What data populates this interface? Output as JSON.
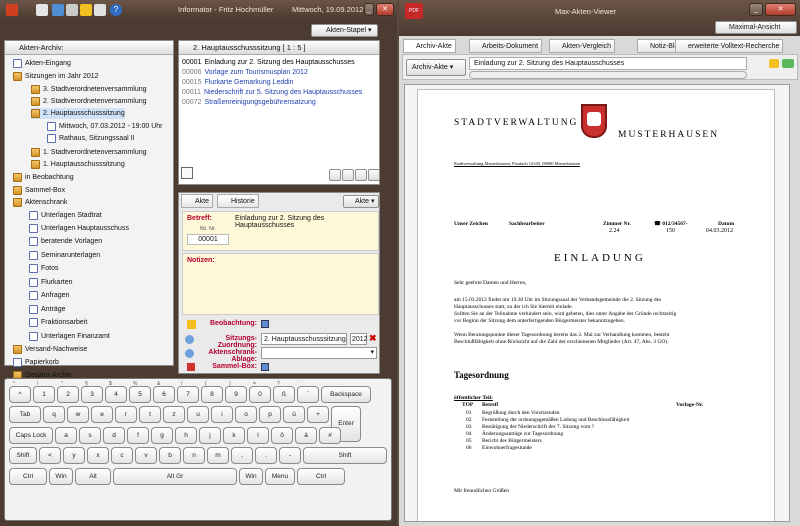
{
  "left_window": {
    "title_user": "Informator - Fritz Hochmüller",
    "title_date": "Mittwoch, 19.09.2012"
  },
  "right_window": {
    "title": "Max-Akten-Viewer",
    "maximal_button": "Maximal-Ansicht"
  },
  "archive": {
    "header": "Akten-Archiv:",
    "tree": [
      {
        "label": "Akten-Eingang"
      },
      {
        "label": "Sitzungen im Jahr 2012"
      },
      {
        "label": "3. Stadtverordnetenversammlung"
      },
      {
        "label": "2. Stadtverordnetenversammlung"
      },
      {
        "label": "2. Hauptausschusssitzung"
      },
      {
        "label": "Mittwoch, 07.03.2012 - 19:00 Uhr"
      },
      {
        "label": "Rathaus, Sitzungssaal  II"
      },
      {
        "label": "1. Stadtverordnetenversammlung"
      },
      {
        "label": "1. Hauptausschusssitzung"
      },
      {
        "label": "in Beobachtung"
      },
      {
        "label": "Sammel-Box"
      },
      {
        "label": "Aktenschrank"
      },
      {
        "label": "Unterlagen Stadtrat"
      },
      {
        "label": "Unterlagen Hauptausschuss"
      },
      {
        "label": "beratende Vorlagen"
      },
      {
        "label": "Seminarunterlagen"
      },
      {
        "label": "Fotos"
      },
      {
        "label": "Flurkarten"
      },
      {
        "label": "Anfragen"
      },
      {
        "label": "Anträge"
      },
      {
        "label": "Fraktionsarbeit"
      },
      {
        "label": "Unterlagen Finanzamt"
      },
      {
        "label": "Versand-Nachweise"
      },
      {
        "label": "Papierkorb"
      },
      {
        "label": "Gesamt-Archiv"
      }
    ]
  },
  "stapel": {
    "button": "Akten-Stapel"
  },
  "session": {
    "header": "2. Hauptausschusssitzung   [ 1 : 5 ]",
    "items": [
      {
        "num": "00001",
        "text": "Einladung zur 2. Sitzung des Hauptausschusses"
      },
      {
        "num": "00006",
        "text": "Vorlage zum Tourismusplan 2012"
      },
      {
        "num": "00015",
        "text": "Flurkarte Gemarkung Leddin"
      },
      {
        "num": "00011",
        "text": "Niederschrift zur 5. Sitzung des Hauptausschusses"
      },
      {
        "num": "00072",
        "text": "Straßenreinigungsgebührensatzung"
      }
    ]
  },
  "akte": {
    "tab_akte": "Akte",
    "tab_historie": "Historie",
    "akte_button": "Akte",
    "betreff_label": "Betreff:",
    "lfd_label": "lfd. Nr.",
    "lfd_value": "00001",
    "betreff_value": "Einladung zur 2. Sitzung des Hauptausschusses",
    "notizen_label": "Notizen:",
    "beobachtung_label": "Beobachtung:",
    "sitzung_label": "Sitzungs-Zuordnung:",
    "sitzung_value": "2. Hauptausschusssitzung",
    "sitzung_year": "2012",
    "aktenschrank_label": "Aktenschrank-Ablage:",
    "sammelbox_label": "Sammel-Box:"
  },
  "keyboard": {
    "row1": [
      "^",
      "1",
      "2",
      "3",
      "4",
      "5",
      "6",
      "7",
      "8",
      "9",
      "0",
      "ß",
      "´",
      "Backspace"
    ],
    "row2": [
      "Tab",
      "q",
      "w",
      "e",
      "r",
      "t",
      "z",
      "u",
      "i",
      "o",
      "p",
      "ü",
      "+",
      "Enter"
    ],
    "row3": [
      "Caps Lock",
      "a",
      "s",
      "d",
      "f",
      "g",
      "h",
      "j",
      "k",
      "l",
      "ö",
      "ä",
      "#"
    ],
    "row4": [
      "Shift",
      "<",
      "y",
      "x",
      "c",
      "v",
      "b",
      "n",
      "m",
      ",",
      ".",
      "-",
      "Shift"
    ],
    "row5": [
      "Ctrl",
      "Win",
      "Alt",
      "Alt Gr",
      "Win",
      "Menu",
      "Ctrl"
    ],
    "shift_row1": [
      "°",
      "!",
      "\"",
      "§",
      "$",
      "%",
      "&",
      "/",
      "(",
      ")",
      "=",
      "?",
      "`"
    ]
  },
  "viewer": {
    "tabs": [
      "Archiv-Akte",
      "Arbeits-Dokument",
      "Akten-Vergleich",
      "Notiz-Blatt",
      "erweiterte Volltext-Recherche"
    ],
    "dropdown": "Archiv-Akte",
    "field": "Einladung zur 2. Sitzung des Hauptausschusses"
  },
  "letter": {
    "org_left": "STADTVERWALTUNG",
    "org_right": "MUSTERHAUSEN",
    "address": "Stadtverwaltung Musterhausen, Postfach 12345, 00000 Musterhausen",
    "col1": "Unser Zeichen",
    "col2": "Sachbearbeiter",
    "col3": "Zimmer Nr.",
    "col3_val": "2.24",
    "col4": "☎ 012/34567-",
    "col4_val": "150",
    "col5": "Datum",
    "col5_val": "04.03.2012",
    "heading": "EINLADUNG",
    "salutation": "Sehr geehrte Damen und Herren,",
    "p1_l1": "am 15.03.2012 findet um 19.30 Uhr im Sitzungssaal der Verbandsgemeinde die 2. Sitzung des",
    "p1_l2": "Hauptausschusses statt, zu der ich Sie hiermit einlade.",
    "p1_l3": "Sollten Sie an der Teilnahme verhindert sein, wird gebeten, dies unter Angabe der Gründe rechtzeitig",
    "p1_l4": "vor Beginn der Sitzung dem unterfertigenden Bürgermeister bekanntzugeben.",
    "p2_l1": "Wenn Beratungspunkte dieser Tagesordnung bereits das 2. Mal zur Verhandlung kommen, besteht",
    "p2_l2": "Beschlußfähigkeit ohne Rücksicht auf die Zahl der erschienenen Mitglieder (Art. 47, Abs. 3 GO).",
    "agenda_title": "Tagesordnung",
    "public": "öffentlicher Teil:",
    "top_h": "TOP",
    "betreff_h": "Betreff",
    "vorlage_h": "Vorlage-Nr.",
    "agenda": [
      {
        "num": "01",
        "text": "Begrüßung durch den Vorsitzenden"
      },
      {
        "num": "02",
        "text": "Feststellung der ordnungsgemäßen Ladung und Beschlussfähigkeit"
      },
      {
        "num": "03",
        "text": "Bestätigung der Niederschrift der 7. Sitzung vom ?"
      },
      {
        "num": "04",
        "text": "Änderungsanträge zur Tagesordnung"
      },
      {
        "num": "05",
        "text": "Bericht des Bürgermeisters"
      },
      {
        "num": "06",
        "text": "Einwohnerfragestunde"
      }
    ],
    "closing": "Mit freundlichen Grüßen"
  }
}
